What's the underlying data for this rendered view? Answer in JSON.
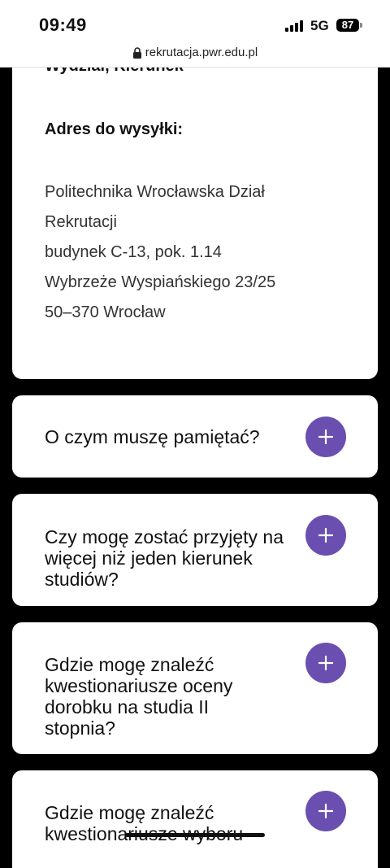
{
  "status_bar": {
    "time": "09:49",
    "network": "5G",
    "battery": "87"
  },
  "browser": {
    "url": "rekrutacja.pwr.edu.pl"
  },
  "address_card": {
    "cut_heading": "Wydział, Kierunek",
    "title": "Adres do wysyłki:",
    "lines": [
      "Politechnika Wrocławska Dział",
      "Rekrutacji",
      "budynek C-13, pok. 1.14",
      "Wybrzeże Wyspiańskiego 23/25",
      "50–370 Wrocław"
    ]
  },
  "faq": [
    {
      "question": "O czym muszę pamiętać?"
    },
    {
      "question": "Czy mogę zostać przyjęty na więcej niż jeden kierunek studiów?"
    },
    {
      "question": "Gdzie mogę znaleźć kwestionariusze oceny dorobku na studia II stopnia?"
    },
    {
      "question": "Gdzie mogę znaleźć kwestionariusze wyboru"
    }
  ]
}
